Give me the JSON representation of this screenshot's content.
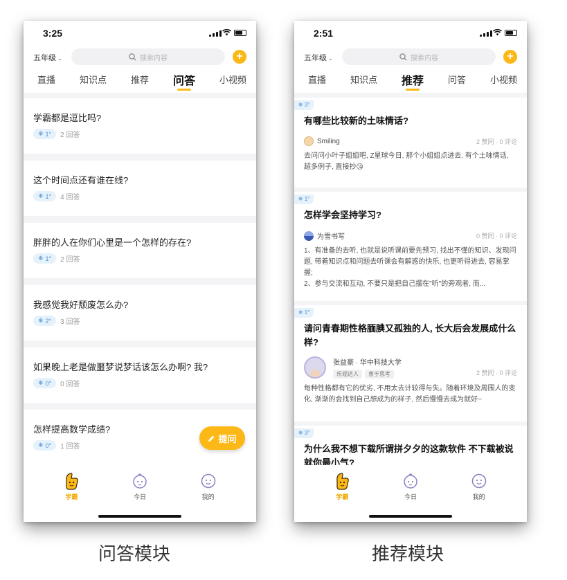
{
  "left_phone": {
    "status_time": "3:25",
    "grade": "五年级",
    "search_placeholder": "搜索内容",
    "tabs": [
      {
        "label": "直播",
        "active": false
      },
      {
        "label": "知识点",
        "active": false
      },
      {
        "label": "推荐",
        "active": false
      },
      {
        "label": "问答",
        "active": true
      },
      {
        "label": "小视频",
        "active": false
      }
    ],
    "questions": [
      {
        "title": "学霸都是逗比吗?",
        "likes": "1°",
        "answers": "2 回答"
      },
      {
        "title": "这个时间点还有谁在线?",
        "likes": "1°",
        "answers": "4 回答"
      },
      {
        "title": "胖胖的人在你们心里是一个怎样的存在?",
        "likes": "1°",
        "answers": "2 回答"
      },
      {
        "title": "我感觉我好颓废怎么办?",
        "likes": "2°",
        "answers": "3 回答"
      },
      {
        "title": "如果晚上老是做噩梦说梦话该怎么办啊? 我?",
        "likes": "0°",
        "answers": "0 回答"
      },
      {
        "title": "怎样提高数学成绩?",
        "likes": "0°",
        "answers": "1 回答"
      }
    ],
    "ask_button": "提问",
    "bottom_tabs": [
      {
        "label": "学霸",
        "icon": "thumbs-up-mascot-icon",
        "active": true
      },
      {
        "label": "今日",
        "icon": "baby-face-icon",
        "active": false
      },
      {
        "label": "我的",
        "icon": "smiley-face-icon",
        "active": false
      }
    ]
  },
  "right_phone": {
    "status_time": "2:51",
    "grade": "五年级",
    "search_placeholder": "搜索内容",
    "tabs": [
      {
        "label": "直播",
        "active": false
      },
      {
        "label": "知识点",
        "active": false
      },
      {
        "label": "推荐",
        "active": true
      },
      {
        "label": "问答",
        "active": false
      },
      {
        "label": "小视频",
        "active": false
      }
    ],
    "cards": [
      {
        "tag": "3°",
        "title": "有哪些比较新的土味情话?",
        "author": "Smiling",
        "stats": "2 赞同 · 0 评论",
        "body": "去问问小叶子姐姐吧, Z星球今日, 那个小姐姐点进去, 有个土味情话, 超多例子, 直接抄😘"
      },
      {
        "tag": "1°",
        "title": "怎样学会坚持学习?",
        "author": "为雪书写",
        "stats": "0 赞同 · 0 评论",
        "body_lines": [
          "1、有准备的去听, 也就是说听课前要先预习, 找出不懂的知识、发现问题, 带着知识点和问题去听课会有解惑的快乐, 也更听得进去, 容易掌握;",
          "2、参与交流和互动, 不要只是把自己摆在\"听\"的旁观者, 而..."
        ]
      },
      {
        "tag": "1°",
        "title": "请问青春期性格腼腆又孤独的人, 长大后会发展成什么样?",
        "author": "张益豪 · 华中科技大学",
        "badges": [
          "乐观达人",
          "衷于思考"
        ],
        "stats": "2 赞同 · 0 评论",
        "body": "每种性格都有它的优劣, 不用太去计较得与失。随着环境及周围人的变化, 渐渐的会找到自己想成为的样子, 然后慢慢去成为就好~"
      },
      {
        "tag": "3°",
        "title": "为什么我不想下载所谓拼夕夕的这款软件    不下载被说就你最小气?"
      }
    ],
    "bottom_tabs": [
      {
        "label": "学霸",
        "icon": "thumbs-up-mascot-icon",
        "active": true
      },
      {
        "label": "今日",
        "icon": "baby-face-icon",
        "active": false
      },
      {
        "label": "我的",
        "icon": "smiley-face-icon",
        "active": false
      }
    ]
  },
  "captions": {
    "left": "问答模块",
    "right": "推荐模块"
  },
  "colors": {
    "accent": "#fcb817",
    "tag_bg": "#e6f2fb",
    "tag_text": "#4a8fd0"
  }
}
